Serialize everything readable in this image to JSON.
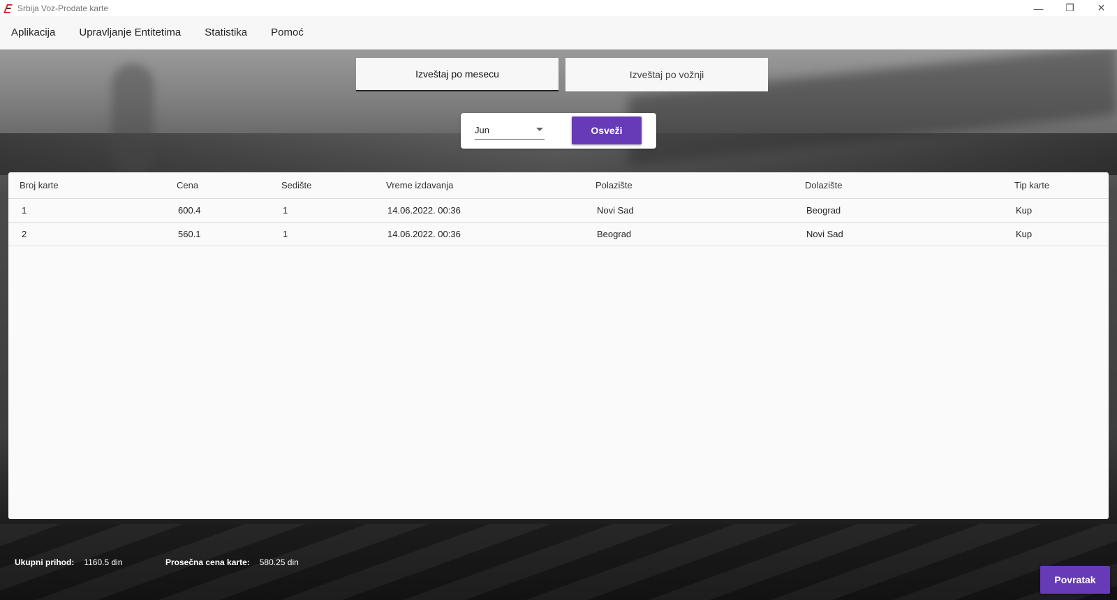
{
  "window": {
    "title": "Srbija Voz-Prodate karte",
    "controls": {
      "minimize": "—",
      "restore": "❐",
      "close": "✕"
    }
  },
  "menu": {
    "items": [
      {
        "label": "Aplikacija"
      },
      {
        "label": "Upravljanje Entitetima"
      },
      {
        "label": "Statistika"
      },
      {
        "label": "Pomoć"
      }
    ]
  },
  "tabs": {
    "month_label": "Izveštaj po mesecu",
    "ride_label": "Izveštaj po vožnji",
    "active": "month"
  },
  "filter": {
    "selected_month": "Jun",
    "refresh_label": "Osveži"
  },
  "table": {
    "headers": [
      "Broj karte",
      "Cena",
      "Sedište",
      "Vreme izdavanja",
      "Polazište",
      "Dolazište",
      "Tip karte"
    ],
    "rows": [
      [
        "1",
        "600.4",
        "1",
        "14.06.2022. 00:36",
        "Novi Sad",
        "Beograd",
        "Kup"
      ],
      [
        "2",
        "560.1",
        "1",
        "14.06.2022. 00:36",
        "Beograd",
        "Novi Sad",
        "Kup"
      ]
    ]
  },
  "summary": {
    "revenue_label": "Ukupni prihod:",
    "revenue_value": "1160.5 din",
    "average_label": "Prosečna cena karte:",
    "average_value": "580.25 din"
  },
  "actions": {
    "back_label": "Povratak"
  },
  "colors": {
    "accent": "#673ab7",
    "logo_red": "#d32f2f"
  }
}
